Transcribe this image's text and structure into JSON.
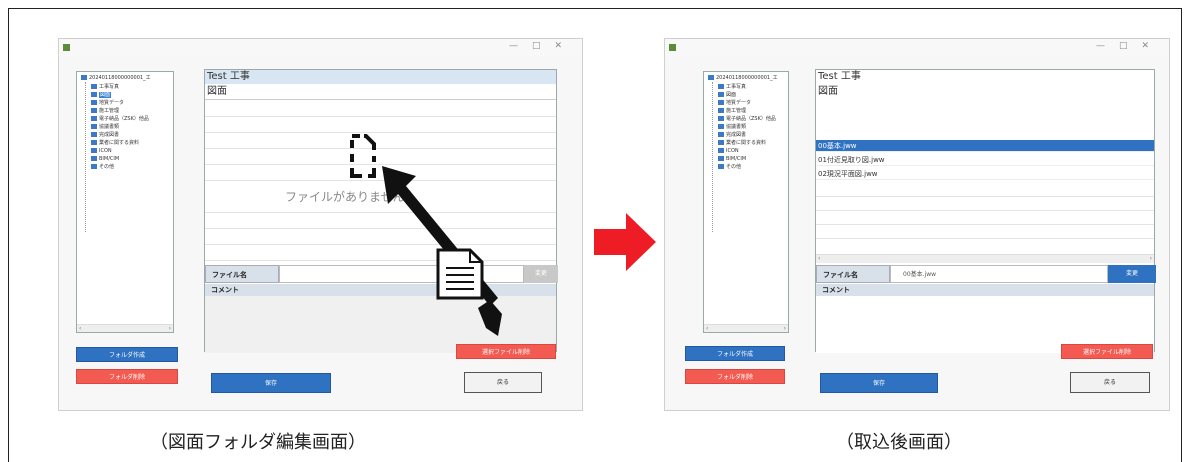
{
  "left": {
    "title": "Test 工事",
    "section": "図面",
    "empty_message": "ファイルがありません",
    "filename_label": "ファイル名",
    "filename_value": "",
    "change_label": "変更",
    "comment_label": "コメント",
    "delete_selected_label": "選択ファイル削除",
    "save_label": "保存",
    "back_label": "戻る",
    "create_folder_label": "フォルダ作成",
    "delete_folder_label": "フォルダ削除"
  },
  "right": {
    "title": "Test 工事",
    "section": "図面",
    "files": [
      "00基本.jww",
      "01付近見取り図.jww",
      "02現況平面図.jww"
    ],
    "filename_label": "ファイル名",
    "filename_value": "00基本.jww",
    "change_label": "変更",
    "comment_label": "コメント",
    "delete_selected_label": "選択ファイル削除",
    "save_label": "保存",
    "back_label": "戻る",
    "create_folder_label": "フォルダ作成",
    "delete_folder_label": "フォルダ削除"
  },
  "tree": {
    "root": "20240118000000001_工",
    "items": [
      "工事写真",
      "図面",
      "地質データ",
      "施工管理",
      "電子納品（ZSK）他品",
      "協議書類",
      "完成図書",
      "業者に関する資料",
      "ICON",
      "BIM/CIM",
      "その他"
    ]
  },
  "captions": {
    "left": "（図面フォルダ編集画面）",
    "right": "（取込後画面）"
  },
  "colors": {
    "accent_blue": "#2f72c2",
    "accent_red": "#f25a52",
    "arrow_red": "#ee1c24"
  }
}
